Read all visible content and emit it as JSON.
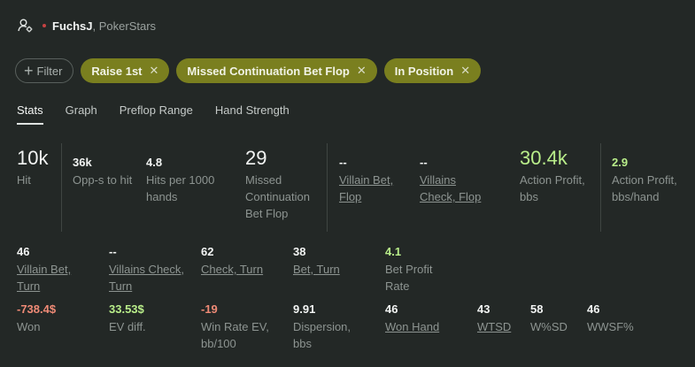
{
  "header": {
    "player": "FuchsJ",
    "site": ", PokerStars"
  },
  "filters": {
    "add_label": "Filter",
    "chips": [
      "Raise 1st",
      "Missed Continuation Bet Flop",
      "In Position"
    ]
  },
  "tabs": [
    "Stats",
    "Graph",
    "Preflop Range",
    "Hand Strength"
  ],
  "stats_row1": [
    {
      "value": "10k",
      "label": "Hit"
    },
    {
      "value": "36k",
      "label": "Opp-s to hit"
    },
    {
      "value": "4.8",
      "label": "Hits per 1000 hands"
    },
    {
      "value": "29",
      "label": "Missed Continuation Bet Flop"
    },
    {
      "value": "--",
      "label": "Villain Bet, Flop"
    },
    {
      "value": "--",
      "label": "Villains Check, Flop"
    },
    {
      "value": "30.4k",
      "label": "Action Profit, bbs"
    },
    {
      "value": "2.9",
      "label": "Action Profit, bbs/hand"
    }
  ],
  "stats_row2": [
    {
      "value": "46",
      "label": "Villain Bet, Turn"
    },
    {
      "value": "--",
      "label": "Villains Check, Turn"
    },
    {
      "value": "62",
      "label": "Check, Turn"
    },
    {
      "value": "38",
      "label": "Bet, Turn"
    },
    {
      "value": "4.1",
      "label": "Bet Profit Rate"
    }
  ],
  "stats_row3": [
    {
      "value": "-738.4$",
      "label": "Won"
    },
    {
      "value": "33.53$",
      "label": "EV diff."
    },
    {
      "value": "-19",
      "label": "Win Rate EV, bb/100"
    },
    {
      "value": "9.91",
      "label": "Dispersion, bbs"
    },
    {
      "value": "46",
      "label": "Won Hand"
    },
    {
      "value": "43",
      "label": "WTSD"
    },
    {
      "value": "58",
      "label": "W%SD"
    },
    {
      "value": "46",
      "label": "WWSF%"
    }
  ],
  "colors": {
    "chip": "#7a7f1f",
    "positive": "#b9ee8a",
    "negative": "#ef8a76"
  }
}
